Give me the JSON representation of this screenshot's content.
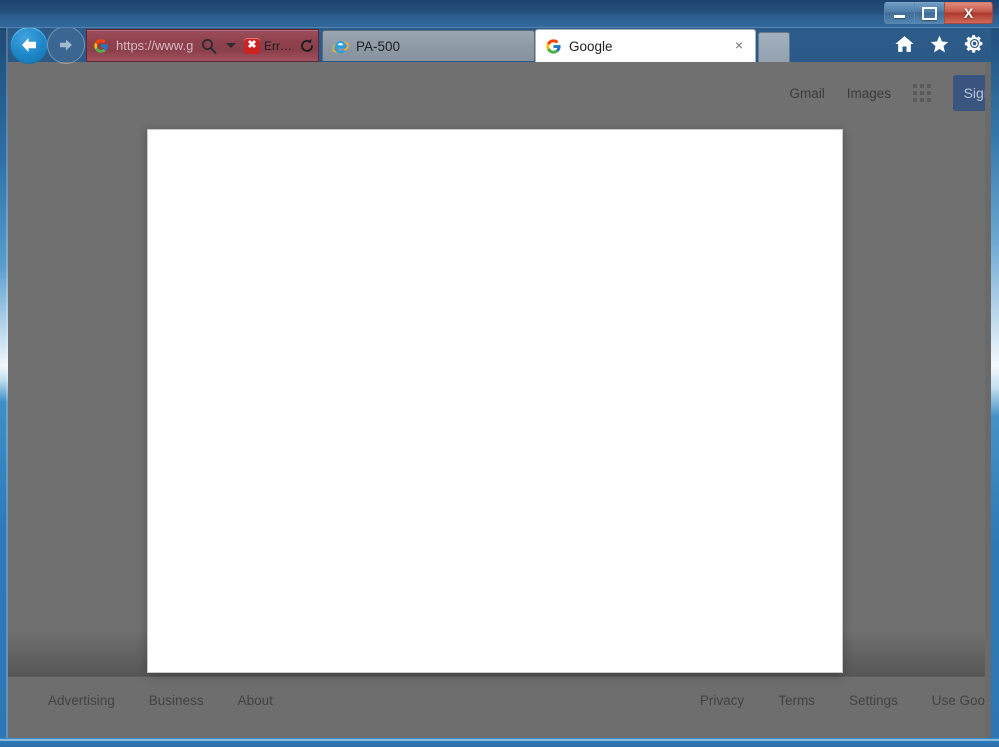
{
  "window": {
    "controls": {
      "minimize": "minimize-button",
      "maximize": "maximize-button",
      "close_label": "X"
    }
  },
  "browser": {
    "navigation": {
      "back_label": "Back",
      "forward_label": "Forward"
    },
    "address_bar": {
      "url_text": "https://www.g",
      "favicon": "google-g-icon",
      "search_icon": "magnifier-icon",
      "dropdown_icon": "chevron-down-icon",
      "error_badge_icon": "red-error-shield-icon",
      "error_badge_text": "Err…",
      "refresh_icon": "refresh-icon"
    },
    "tabs": [
      {
        "label": "PA-500",
        "favicon": "internet-explorer-icon",
        "active": false
      },
      {
        "label": "Google",
        "favicon": "google-g-icon",
        "active": true,
        "close_label": "×"
      }
    ],
    "new_tab_label": "New tab",
    "toolbar_icons": [
      {
        "name": "home-icon",
        "label": "Home"
      },
      {
        "name": "favorites-star-icon",
        "label": "Favorites"
      },
      {
        "name": "settings-gear-icon",
        "label": "Tools"
      }
    ]
  },
  "page": {
    "header_links": [
      {
        "label": "Gmail"
      },
      {
        "label": "Images"
      }
    ],
    "apps_icon": "apps-grid-icon",
    "sign_in_label": "Sign in",
    "modal": {
      "name": "blank-white-dialog",
      "content": ""
    },
    "footer": {
      "left_links": [
        {
          "label": "Advertising"
        },
        {
          "label": "Business"
        },
        {
          "label": "About"
        }
      ],
      "right_links": [
        {
          "label": "Privacy"
        },
        {
          "label": "Terms"
        },
        {
          "label": "Settings"
        },
        {
          "label": "Use Goo"
        }
      ]
    }
  },
  "colors": {
    "titlebar": "#27527f",
    "address_bar_error": "#90434f",
    "error_red": "#cc2222",
    "scrim": "#707070",
    "footer": "#6e6e6e",
    "signin_blue": "#3a5480",
    "frame_blue": "#2f7ab5"
  }
}
